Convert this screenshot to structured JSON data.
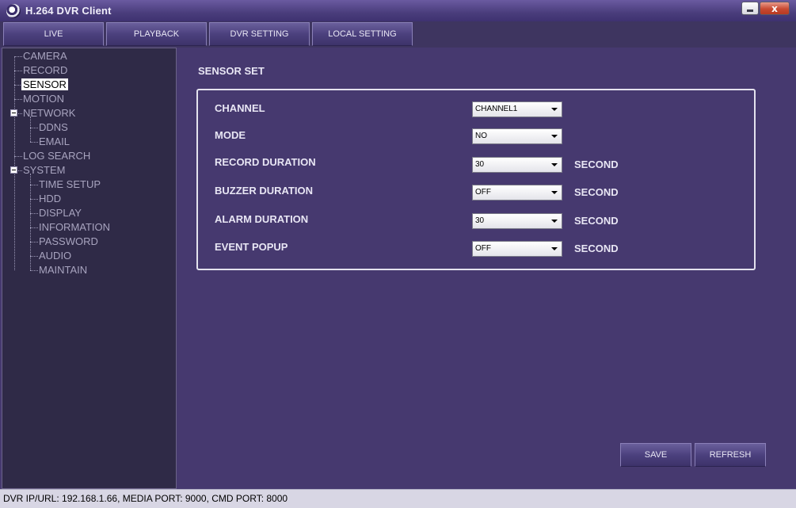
{
  "window": {
    "title": "H.264 DVR Client",
    "close_glyph": "x"
  },
  "nav": {
    "tabs": [
      {
        "label": "LIVE"
      },
      {
        "label": "PLAYBACK"
      },
      {
        "label": "DVR SETTING"
      },
      {
        "label": "LOCAL SETTING"
      }
    ]
  },
  "sidebar": {
    "items": [
      {
        "label": "CAMERA"
      },
      {
        "label": "RECORD"
      },
      {
        "label": "SENSOR",
        "selected": true
      },
      {
        "label": "MOTION"
      },
      {
        "label": "NETWORK",
        "expanded": true
      },
      {
        "label": "DDNS"
      },
      {
        "label": "EMAIL"
      },
      {
        "label": "LOG SEARCH"
      },
      {
        "label": "SYSTEM",
        "expanded": true
      },
      {
        "label": "TIME SETUP"
      },
      {
        "label": "HDD"
      },
      {
        "label": "DISPLAY"
      },
      {
        "label": "INFORMATION"
      },
      {
        "label": "PASSWORD"
      },
      {
        "label": "AUDIO"
      },
      {
        "label": "MAINTAIN"
      }
    ]
  },
  "main": {
    "title": "SENSOR SET",
    "fields": [
      {
        "label": "CHANNEL",
        "value": "CHANNEL1",
        "unit": ""
      },
      {
        "label": "MODE",
        "value": "NO",
        "unit": ""
      },
      {
        "label": "RECORD DURATION",
        "value": "30",
        "unit": "SECOND"
      },
      {
        "label": "BUZZER DURATION",
        "value": "OFF",
        "unit": "SECOND"
      },
      {
        "label": "ALARM DURATION",
        "value": "30",
        "unit": "SECOND"
      },
      {
        "label": "EVENT POPUP",
        "value": "OFF",
        "unit": "SECOND"
      }
    ],
    "save_label": "SAVE",
    "refresh_label": "REFRESH"
  },
  "status": {
    "text": "DVR IP/URL: 192.168.1.66, MEDIA PORT: 9000, CMD PORT: 8000"
  },
  "colors": {
    "background": "#46396f",
    "sidebar": "#2f2a47",
    "tab": "#4c417e",
    "statusbar": "#d8d6e4"
  }
}
